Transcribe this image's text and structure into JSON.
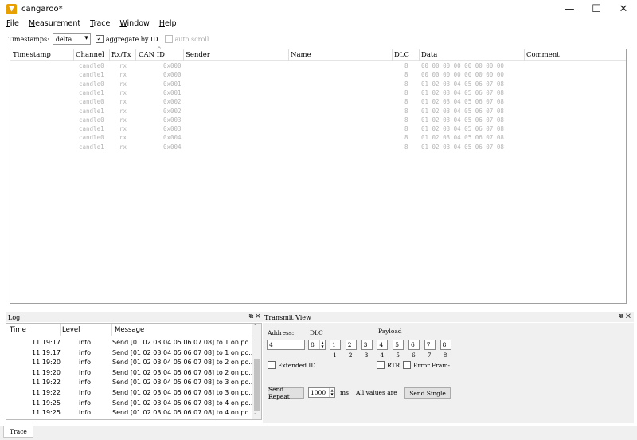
{
  "window": {
    "title": "cangaroo*",
    "minimize": "—",
    "maximize": "☐",
    "close": "✕"
  },
  "menu": {
    "file": "File",
    "measurement": "Measurement",
    "trace": "Trace",
    "window": "Window",
    "help": "Help"
  },
  "toolbar": {
    "timestamps_label": "Timestamps:",
    "timestamps_value": "delta",
    "aggregate_label": "aggregate by ID",
    "aggregate_checked": true,
    "autoscroll_label": "auto scroll",
    "autoscroll_checked": false
  },
  "trace": {
    "columns": [
      "Timestamp",
      "Channel",
      "Rx/Tx",
      "CAN ID",
      "Sender",
      "Name",
      "DLC",
      "Data",
      "Comment"
    ],
    "rows": [
      {
        "channel": "candle0",
        "rxtx": "rx",
        "id": "0x000",
        "dlc": "8",
        "data": "00 00 00 00 00 00 00 00"
      },
      {
        "channel": "candle1",
        "rxtx": "rx",
        "id": "0x000",
        "dlc": "8",
        "data": "00 00 00 00 00 00 00 00"
      },
      {
        "channel": "candle0",
        "rxtx": "rx",
        "id": "0x001",
        "dlc": "8",
        "data": "01 02 03 04 05 06 07 08"
      },
      {
        "channel": "candle1",
        "rxtx": "rx",
        "id": "0x001",
        "dlc": "8",
        "data": "01 02 03 04 05 06 07 08"
      },
      {
        "channel": "candle0",
        "rxtx": "rx",
        "id": "0x002",
        "dlc": "8",
        "data": "01 02 03 04 05 06 07 08"
      },
      {
        "channel": "candle1",
        "rxtx": "rx",
        "id": "0x002",
        "dlc": "8",
        "data": "01 02 03 04 05 06 07 08"
      },
      {
        "channel": "candle0",
        "rxtx": "rx",
        "id": "0x003",
        "dlc": "8",
        "data": "01 02 03 04 05 06 07 08"
      },
      {
        "channel": "candle1",
        "rxtx": "rx",
        "id": "0x003",
        "dlc": "8",
        "data": "01 02 03 04 05 06 07 08"
      },
      {
        "channel": "candle0",
        "rxtx": "rx",
        "id": "0x004",
        "dlc": "8",
        "data": "01 02 03 04 05 06 07 08"
      },
      {
        "channel": "candle1",
        "rxtx": "rx",
        "id": "0x004",
        "dlc": "8",
        "data": "01 02 03 04 05 06 07 08"
      }
    ]
  },
  "log": {
    "title": "Log",
    "columns": [
      "Time",
      "Level",
      "Message"
    ],
    "rows": [
      {
        "time": "11:19:17",
        "level": "info",
        "message": "Send [01 02 03 04 05 06 07 08] to 1 on po..."
      },
      {
        "time": "11:19:17",
        "level": "info",
        "message": "Send [01 02 03 04 05 06 07 08] to 1 on po..."
      },
      {
        "time": "11:19:20",
        "level": "info",
        "message": "Send [01 02 03 04 05 06 07 08] to 2 on po..."
      },
      {
        "time": "11:19:20",
        "level": "info",
        "message": "Send [01 02 03 04 05 06 07 08] to 2 on po..."
      },
      {
        "time": "11:19:22",
        "level": "info",
        "message": "Send [01 02 03 04 05 06 07 08] to 3 on po..."
      },
      {
        "time": "11:19:22",
        "level": "info",
        "message": "Send [01 02 03 04 05 06 07 08] to 3 on po..."
      },
      {
        "time": "11:19:25",
        "level": "info",
        "message": "Send [01 02 03 04 05 06 07 08] to 4 on po..."
      },
      {
        "time": "11:19:25",
        "level": "info",
        "message": "Send [01 02 03 04 05 06 07 08] to 4 on po..."
      }
    ]
  },
  "transmit": {
    "title": "Transmit View",
    "address_label": "Address:",
    "address_value": "4",
    "dlc_label": "DLC",
    "dlc_value": "8",
    "payload_label": "Payload",
    "payload": [
      "1",
      "2",
      "3",
      "4",
      "5",
      "6",
      "7",
      "8"
    ],
    "payload_index": [
      "1",
      "2",
      "3",
      "4",
      "5",
      "6",
      "7",
      "8"
    ],
    "extended_id_label": "Extended ID",
    "rtr_label": "RTR",
    "error_frame_label": "Error Fram-",
    "send_repeat_label": "Send Repeat",
    "repeat_value": "1000",
    "ms_label": "ms",
    "all_values_label": "All values are",
    "send_single_label": "Send Single"
  },
  "dock_buttons": {
    "float": "⧉",
    "close": "✕"
  },
  "tabs": {
    "trace": "Trace"
  }
}
